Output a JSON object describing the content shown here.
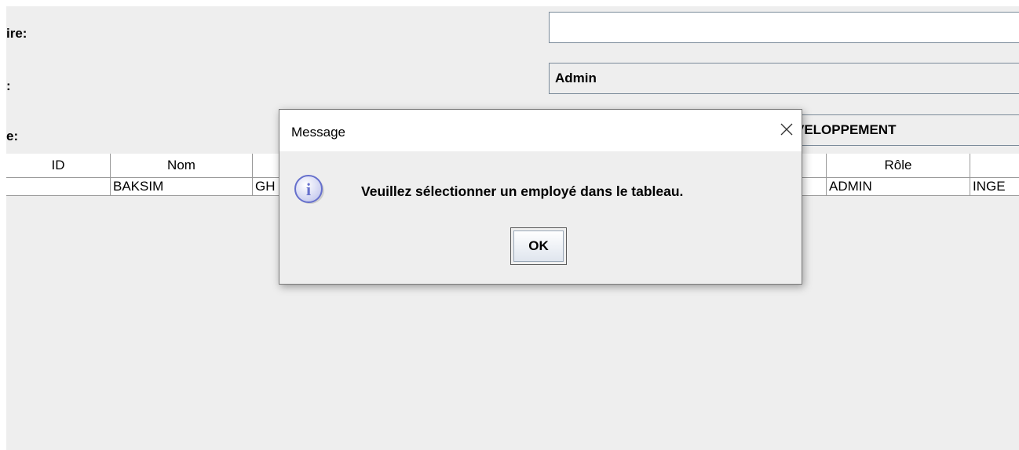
{
  "form": {
    "labels": [
      "ire:",
      ":",
      "e:"
    ],
    "fields": {
      "text_value": "",
      "role_combo_value": "Admin",
      "department_combo_value": "VELOPPEMENT"
    }
  },
  "table": {
    "columns": [
      "ID",
      "Nom",
      "Rôle"
    ],
    "row": {
      "id": "",
      "nom": "BAKSIM",
      "prenom_partial": "GH",
      "role": "ADMIN",
      "poste_partial": "INGE"
    }
  },
  "dialog": {
    "title": "Message",
    "message": "Veuillez sélectionner un employé dans le tableau.",
    "ok_label": "OK",
    "icon": "info-icon",
    "close_icon": "close-icon"
  },
  "colors": {
    "panel_bg": "#eeeeee",
    "border": "#7a8a99",
    "info_icon": "#6670cc"
  }
}
